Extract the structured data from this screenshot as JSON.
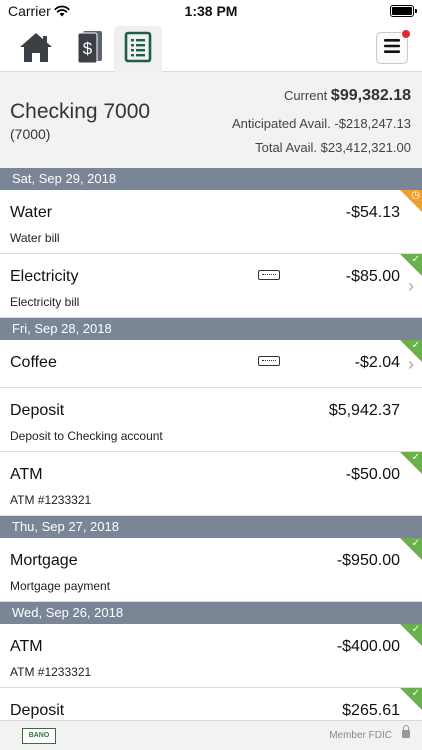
{
  "status_bar": {
    "carrier": "Carrier",
    "time": "1:38 PM"
  },
  "nav": {
    "tabs": [
      {
        "icon": "home-icon"
      },
      {
        "icon": "transfer-money-icon"
      },
      {
        "icon": "account-register-icon",
        "active": true
      }
    ],
    "menu_icon": "hamburger-menu-icon",
    "notification_color": "#e3262c"
  },
  "account": {
    "name": "Checking 7000",
    "number": "(7000)",
    "current_label": "Current",
    "current_value": "$99,382.18",
    "anticipated": "Anticipated Avail. -$218,247.13",
    "total": "Total Avail. $23,412,321.00"
  },
  "groups": [
    {
      "date": "Sat, Sep 29, 2018",
      "transactions": [
        {
          "desc": "Water",
          "memo": "Water bill",
          "amount": "-$54.13",
          "status": "pending"
        },
        {
          "desc": "Electricity",
          "memo": "Electricity bill",
          "amount": "-$85.00",
          "status": "cleared",
          "receipt": true
        }
      ]
    },
    {
      "date": "Fri, Sep 28, 2018",
      "transactions": [
        {
          "desc": "Coffee",
          "memo": "",
          "amount": "-$2.04",
          "status": "cleared",
          "receipt": true
        },
        {
          "desc": "Deposit",
          "memo": "Deposit to Checking account",
          "amount": "$5,942.37",
          "status": "none"
        },
        {
          "desc": "ATM",
          "memo": "ATM #1233321",
          "amount": "-$50.00",
          "status": "cleared"
        }
      ]
    },
    {
      "date": "Thu, Sep 27, 2018",
      "transactions": [
        {
          "desc": "Mortgage",
          "memo": "Mortgage payment",
          "amount": "-$950.00",
          "status": "cleared"
        }
      ]
    },
    {
      "date": "Wed, Sep 26, 2018",
      "transactions": [
        {
          "desc": "ATM",
          "memo": "ATM #1233321",
          "amount": "-$400.00",
          "status": "cleared"
        },
        {
          "desc": "Deposit",
          "memo": "",
          "amount": "$265.61",
          "status": "cleared"
        }
      ]
    }
  ],
  "footer": {
    "logo_text": "BANO",
    "member": "Member FDIC"
  },
  "colors": {
    "date_header": "#7a8596",
    "cleared": "#6ab04c",
    "pending": "#f0a030"
  }
}
